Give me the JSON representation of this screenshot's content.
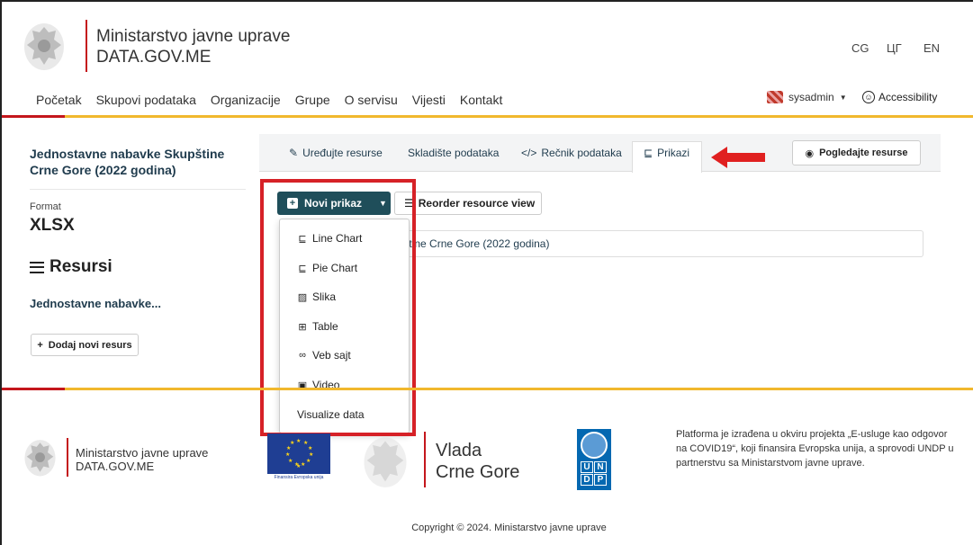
{
  "header": {
    "brand_line1": "Ministarstvo javne uprave",
    "brand_line2": "DATA.GOV.ME",
    "languages": [
      "CG",
      "ЦГ",
      "EN"
    ]
  },
  "nav": {
    "items": [
      "Početak",
      "Skupovi podataka",
      "Organizacije",
      "Grupe",
      "O servisu",
      "Vijesti",
      "Kontakt"
    ],
    "user": "sysadmin",
    "accessibility": "Accessibility"
  },
  "sidebar": {
    "resource_title": "Jednostavne nabavke Skupštine Crne Gore (2022 godina)",
    "format_label": "Format",
    "format_value": "XLSX",
    "resources_heading": "Resursi",
    "resource_link": "Jednostavne nabavke...",
    "add_resource": "Dodaj novi resurs"
  },
  "tabs": {
    "edit": "Uređujte resurse",
    "datastore": "Skladište podataka",
    "dictionary": "Rečnik podataka",
    "views": "Prikazi",
    "view_resource": "Pogledajte resurse"
  },
  "actions": {
    "new_view": "Novi prikaz",
    "reorder": "Reorder resource view"
  },
  "view_row": "e Skupštine Crne Gore (2022 godina)",
  "dropdown": {
    "items": [
      {
        "label": "Line Chart",
        "icon": "line-chart-icon"
      },
      {
        "label": "Pie Chart",
        "icon": "line-chart-icon"
      },
      {
        "label": "Slika",
        "icon": "image-icon"
      },
      {
        "label": "Table",
        "icon": "table-icon"
      },
      {
        "label": "Veb sajt",
        "icon": "link-icon"
      },
      {
        "label": "Video",
        "icon": "video-icon"
      },
      {
        "label": "Visualize data",
        "icon": ""
      }
    ]
  },
  "footer": {
    "brand_line1": "Ministarstvo javne uprave",
    "brand_line2": "DATA.GOV.ME",
    "eu_caption": "Finansira Evropska unija",
    "gov_line1": "Vlada",
    "gov_line2": "Crne Gore",
    "description": "Platforma je izrađena u okviru projekta „E-usluge kao odgovor na COVID19“, koji finansira Evropska unija, a sprovodi UNDP u partnerstvu sa Ministarstvom javne uprave.",
    "copyright": "Copyright © 2024. Ministarstvo javne uprave"
  },
  "colors": {
    "brand_red": "#c4161c",
    "brand_yellow": "#f1b82d",
    "primary_button": "#1f4e5a",
    "highlight_red": "#d62127"
  }
}
